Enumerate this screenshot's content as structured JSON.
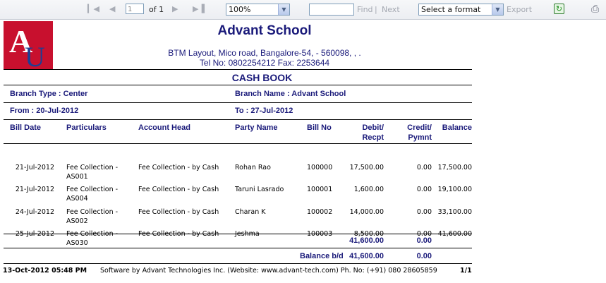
{
  "toolbar": {
    "first_icon": "first-page-icon",
    "prev_icon": "prev-page-icon",
    "next_icon": "next-page-icon",
    "last_icon": "last-page-icon",
    "page_value": "1",
    "page_of": "of 1",
    "zoom_value": "100%",
    "find_value": "",
    "find_label": "Find",
    "separator": "|",
    "next_label": "Next",
    "format_value": "Select a format",
    "export_label": "Export",
    "refresh_icon": "refresh-icon",
    "print_icon": "print-icon"
  },
  "report": {
    "logo_text": "AU",
    "school_name": "Advant School",
    "address": "BTM Layout, Mico road, Bangalore-54, - 560098, , .",
    "phone": "Tel No: 0802254212 Fax: 2253644",
    "title": "CASH BOOK",
    "branch_type": "Branch Type : Center",
    "branch_name": "Branch Name : Advant School",
    "from": "From : 20-Jul-2012",
    "to": "To : 27-Jul-2012",
    "columns": {
      "bill_date": "Bill Date",
      "particulars": "Particulars",
      "account_head": "Account Head",
      "party_name": "Party Name",
      "bill_no": "Bill No",
      "debit_1": "Debit/",
      "debit_2": "Recpt",
      "credit_1": "Credit/",
      "credit_2": "Pymnt",
      "balance": "Balance"
    },
    "rows": [
      {
        "date": "21-Jul-2012",
        "particulars_1": "Fee Collection -",
        "particulars_2": "AS001",
        "account_head": "Fee Collection - by Cash",
        "party": "Rohan Rao",
        "bill_no": "100000",
        "debit": "17,500.00",
        "credit": "0.00",
        "balance": "17,500.00"
      },
      {
        "date": "21-Jul-2012",
        "particulars_1": "Fee Collection -",
        "particulars_2": "AS004",
        "account_head": "Fee Collection - by Cash",
        "party": "Taruni Lasrado",
        "bill_no": "100001",
        "debit": "1,600.00",
        "credit": "0.00",
        "balance": "19,100.00"
      },
      {
        "date": "24-Jul-2012",
        "particulars_1": "Fee Collection -",
        "particulars_2": "AS002",
        "account_head": "Fee Collection - by Cash",
        "party": "Charan K",
        "bill_no": "100002",
        "debit": "14,000.00",
        "credit": "0.00",
        "balance": "33,100.00"
      },
      {
        "date": "25-Jul-2012",
        "particulars_1": "Fee Collection -",
        "particulars_2": "AS030",
        "account_head": "Fee Collection - by Cash",
        "party": "Jeshma",
        "bill_no": "100003",
        "debit": "8,500.00",
        "credit": "0.00",
        "balance": "41,600.00"
      }
    ],
    "total_debit": "41,600.00",
    "total_credit": "0.00",
    "balance_label": "Balance b/d",
    "balance_debit": "41,600.00",
    "balance_credit": "0.00"
  },
  "footer": {
    "timestamp": "13-Oct-2012 05:48 PM",
    "software": "Software by Advant Technologies Inc. (Website: www.advant-tech.com) Ph. No: (+91) 080 28605859",
    "page": "1/1"
  },
  "colors": {
    "heading": "#1a1a7a",
    "logo_red": "#c8102e",
    "logo_blue": "#1c3f94"
  }
}
